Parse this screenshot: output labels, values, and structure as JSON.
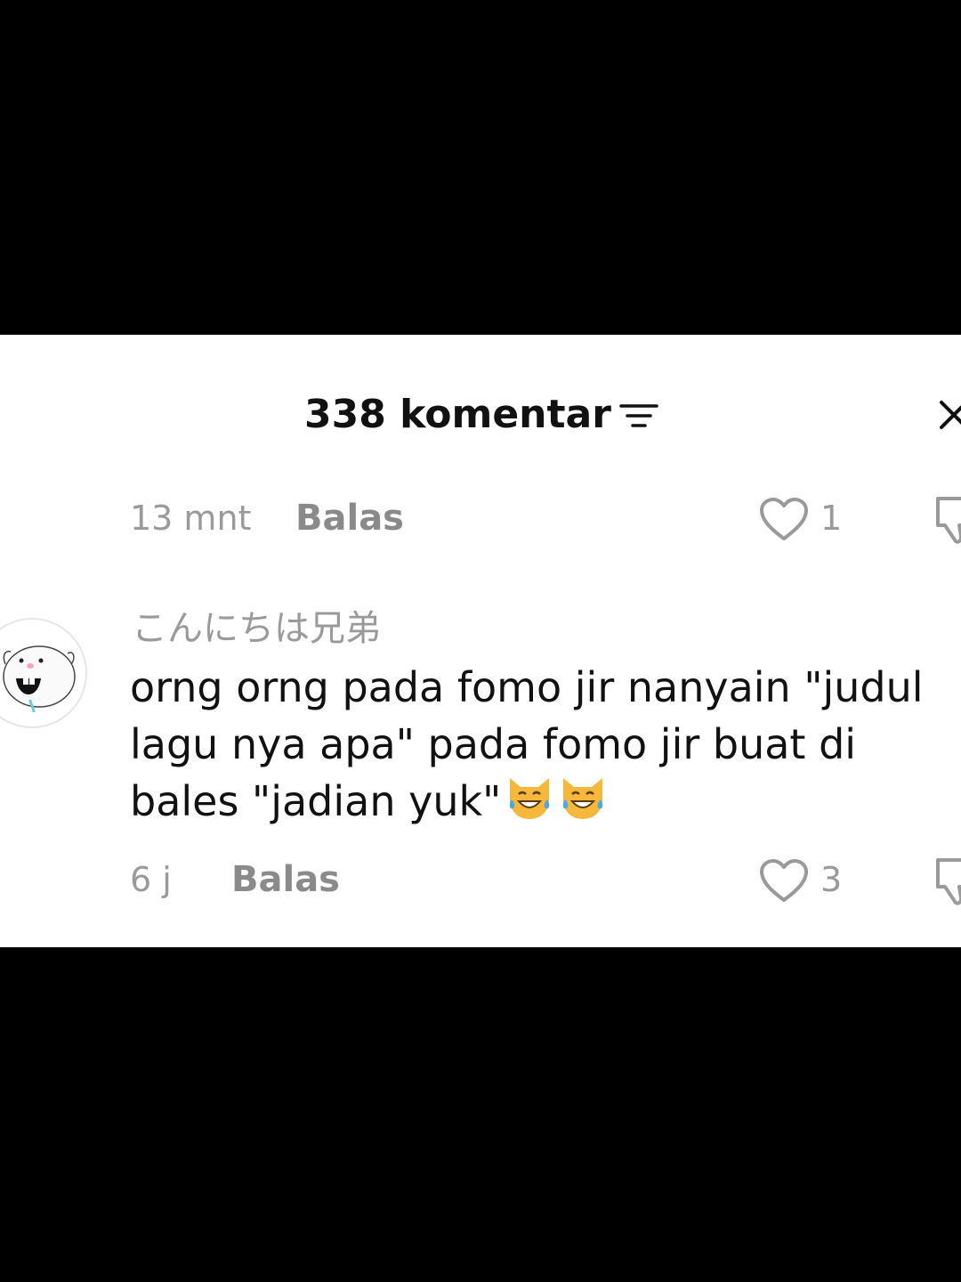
{
  "header": {
    "title": "338 komentar",
    "sort_icon": "filter-lines-icon",
    "close_icon": "close-x-icon"
  },
  "previous_comment_meta": {
    "time": "13 mnt",
    "reply_label": "Balas",
    "like_count": "1"
  },
  "comment": {
    "username": "こんにちは兄弟",
    "avatar_icon": "cartoon-face-avatar",
    "text_lines": [
      "orng orng pada fomo jir nanyain \"judul",
      "lagu nya apa\" pada fomo jir buat di",
      "bales \"jadian yuk\""
    ],
    "emoji": "cat-tears-of-joy-emoji",
    "time": "6 j",
    "reply_label": "Balas",
    "like_count": "3"
  },
  "colors": {
    "background": "#000000",
    "panel": "#ffffff",
    "text_primary": "#111111",
    "text_secondary": "#9a9a9a"
  }
}
